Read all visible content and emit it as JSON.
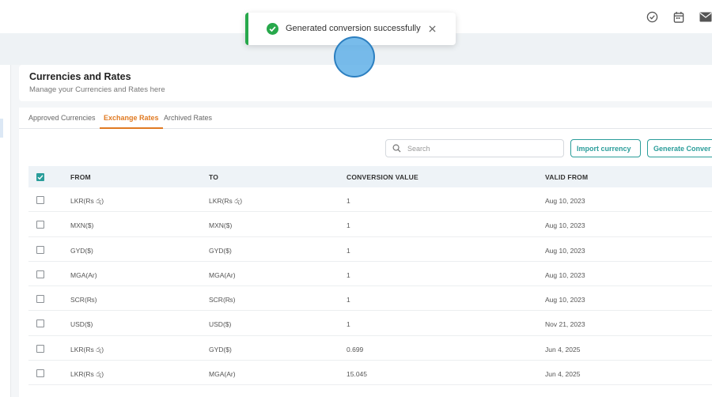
{
  "topbar": {
    "icons": [
      "check-circle-icon",
      "calendar-icon",
      "mail-icon"
    ]
  },
  "header": {
    "title": "Currencies and Rates",
    "subtitle": "Manage your Currencies and Rates here"
  },
  "tabs": [
    {
      "label": "Approved Currencies",
      "active": false
    },
    {
      "label": "Exchange Rates",
      "active": true
    },
    {
      "label": "Archived Rates",
      "active": false
    }
  ],
  "toolbar": {
    "search_placeholder": "Search",
    "import_label": "Import currency",
    "generate_label": "Generate Conver"
  },
  "table": {
    "columns": [
      "FROM",
      "TO",
      "CONVERSION VALUE",
      "VALID FROM"
    ],
    "rows": [
      {
        "from": "LKR(Rs රු)",
        "to": "LKR(Rs රු)",
        "conversion": "1",
        "valid_from": "Aug 10, 2023"
      },
      {
        "from": "MXN($)",
        "to": "MXN($)",
        "conversion": "1",
        "valid_from": "Aug 10, 2023"
      },
      {
        "from": "GYD($)",
        "to": "GYD($)",
        "conversion": "1",
        "valid_from": "Aug 10, 2023"
      },
      {
        "from": "MGA(Ar)",
        "to": "MGA(Ar)",
        "conversion": "1",
        "valid_from": "Aug 10, 2023"
      },
      {
        "from": "SCR(₨)",
        "to": "SCR(₨)",
        "conversion": "1",
        "valid_from": "Aug 10, 2023"
      },
      {
        "from": "USD($)",
        "to": "USD($)",
        "conversion": "1",
        "valid_from": "Nov 21, 2023"
      },
      {
        "from": "LKR(Rs රු)",
        "to": "GYD($)",
        "conversion": "0.699",
        "valid_from": "Jun 4, 2025"
      },
      {
        "from": "LKR(Rs රු)",
        "to": "MGA(Ar)",
        "conversion": "15.045",
        "valid_from": "Jun 4, 2025"
      }
    ]
  },
  "toast": {
    "message": "Generated conversion successfully",
    "type": "success"
  },
  "colors": {
    "accent_teal": "#2a9d9a",
    "active_tab_orange": "#e07a22",
    "success_green": "#27a84b"
  }
}
